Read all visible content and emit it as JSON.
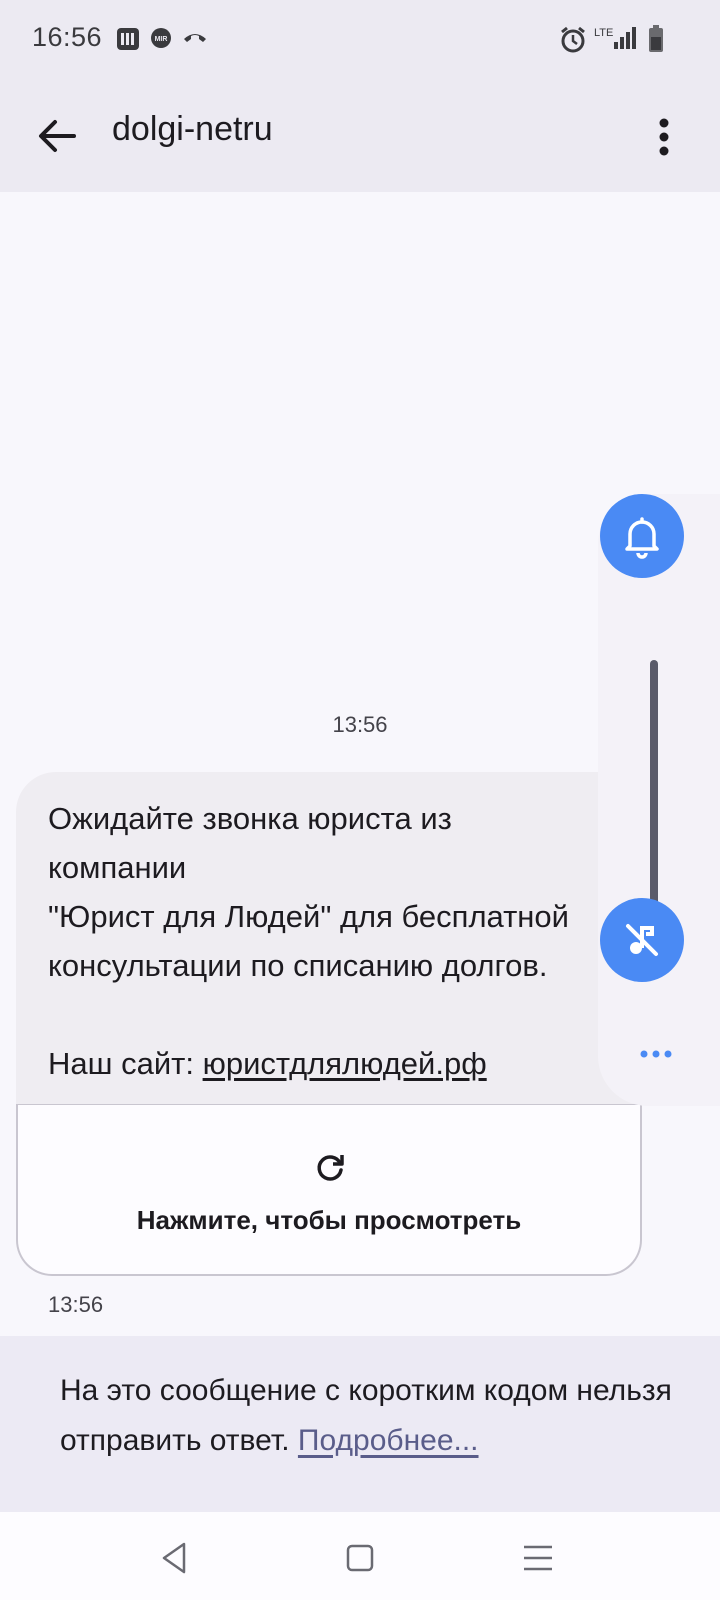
{
  "status_bar": {
    "time": "16:56",
    "icons": [
      "wallet-icon",
      "mir-icon",
      "missed-call-icon",
      "alarm-icon",
      "lte-signal-icon",
      "battery-icon"
    ],
    "network": "LTE"
  },
  "app_bar": {
    "title": "dolgi-netru",
    "back_icon": "arrow-back-icon",
    "menu_icon": "more-vert-icon"
  },
  "conversation": {
    "date_separator": "13:56",
    "message": {
      "text": "Ожидайте звонка юриста из\nкомпании\n\"Юрист для Людей\" для бесплатной\nконсультации по списанию долгов.\n\nНаш сайт: ",
      "link": "юристдлялюдей.рф",
      "time": "13:56"
    },
    "preview": {
      "label": "Нажмите, чтобы просмотреть",
      "icon": "refresh-icon"
    }
  },
  "info_bar": {
    "text": "На это сообщение с коротким кодом нельзя отправить ответ. ",
    "link": "Подробнее..."
  },
  "volume_panel": {
    "top_icon": "bell-icon",
    "bottom_icon": "music-off-icon",
    "more_icon": "more-horiz-icon",
    "accent_color": "#4a8af4"
  },
  "nav_bar": {
    "icons": [
      "nav-back-icon",
      "nav-home-icon",
      "nav-recents-icon"
    ]
  }
}
